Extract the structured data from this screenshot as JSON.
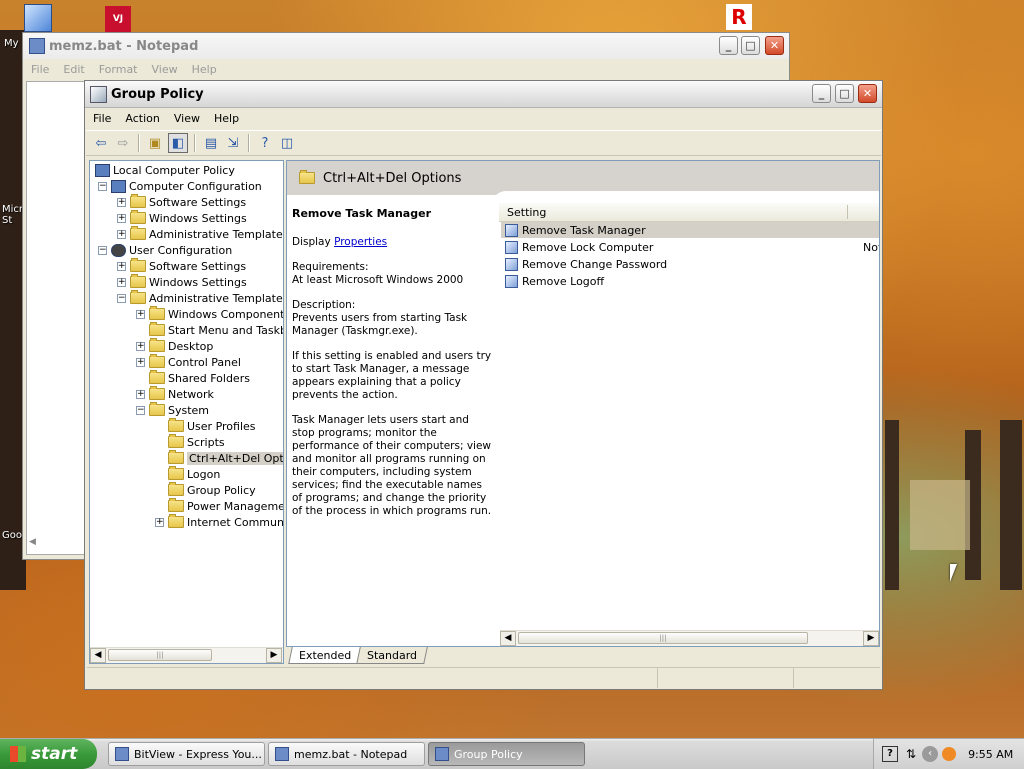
{
  "desktop": {
    "icons": [
      "my-computer-icon",
      "vj-app-icon",
      "roblox-icon"
    ],
    "labels": [
      "My",
      "Micro St",
      "Goo"
    ]
  },
  "notepad": {
    "title": "memz.bat - Notepad",
    "menu": [
      "File",
      "Edit",
      "Format",
      "View",
      "Help"
    ]
  },
  "group_policy": {
    "title": "Group Policy",
    "menu": [
      "File",
      "Action",
      "View",
      "Help"
    ],
    "tree": [
      {
        "label": "Local Computer Policy"
      },
      {
        "label": "Computer Configuration"
      },
      {
        "label": "Software Settings"
      },
      {
        "label": "Windows Settings"
      },
      {
        "label": "Administrative Templates"
      },
      {
        "label": "User Configuration"
      },
      {
        "label": "Software Settings"
      },
      {
        "label": "Windows Settings"
      },
      {
        "label": "Administrative Templates"
      },
      {
        "label": "Windows Components"
      },
      {
        "label": "Start Menu and Taskba"
      },
      {
        "label": "Desktop"
      },
      {
        "label": "Control Panel"
      },
      {
        "label": "Shared Folders"
      },
      {
        "label": "Network"
      },
      {
        "label": "System"
      },
      {
        "label": "User Profiles"
      },
      {
        "label": "Scripts"
      },
      {
        "label": "Ctrl+Alt+Del Optio"
      },
      {
        "label": "Logon"
      },
      {
        "label": "Group Policy"
      },
      {
        "label": "Power Managemen"
      },
      {
        "label": "Internet Communic"
      }
    ],
    "header_title": "Ctrl+Alt+Del Options",
    "description": {
      "title": "Remove Task Manager",
      "display_prefix": "Display",
      "display_link": "Properties",
      "requirements_label": "Requirements:",
      "requirements": "At least Microsoft Windows 2000",
      "description_label": "Description:",
      "description": "Prevents users from starting Task Manager (Taskmgr.exe).",
      "para2": "If this setting is enabled and users try to start Task Manager, a message appears explaining that a policy prevents the action.",
      "para3": "Task Manager lets users start and stop programs; monitor the performance of their computers; view and monitor all programs running on their computers, including system services; find the executable names of programs; and change the priority of the process in which programs run."
    },
    "list": {
      "column_setting": "Setting",
      "rows": [
        {
          "name": "Remove Task Manager",
          "state": ""
        },
        {
          "name": "Remove Lock Computer",
          "state": "Not"
        },
        {
          "name": "Remove Change Password",
          "state": ""
        },
        {
          "name": "Remove Logoff",
          "state": ""
        }
      ]
    },
    "tabs": [
      "Extended",
      "Standard"
    ]
  },
  "taskbar": {
    "start_label": "start",
    "tasks": [
      "BitView - Express You...",
      "memz.bat - Notepad",
      "Group Policy"
    ],
    "clock": "9:55 AM"
  },
  "colors": {
    "selection": "#d4d0c8",
    "link": "#0000cc"
  }
}
